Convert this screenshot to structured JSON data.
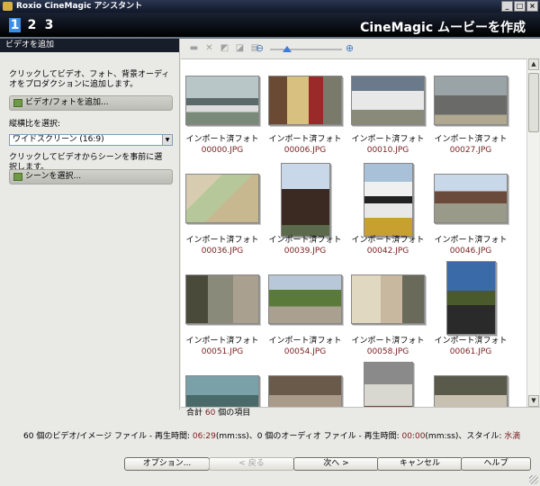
{
  "window": {
    "title": "Roxio CineMagic アシスタント"
  },
  "header": {
    "steps": [
      "1",
      "2",
      "3"
    ],
    "title": "CineMagic ムービーを作成"
  },
  "left_panel": {
    "title": "ビデオを追加",
    "description": "クリックしてビデオ、フォト、背景オーディオをプロダクションに追加します。",
    "add_button": "ビデオ/フォトを追加...",
    "aspect_label": "縦横比を選択:",
    "aspect_value": "ワイドスクリーン (16:9)",
    "scene_description": "クリックしてビデオからシーンを事前に選択します。",
    "scene_button": "シーンを選択..."
  },
  "media": {
    "items": [
      {
        "label": "インポート済フォト",
        "file": "00000.JPG",
        "icon": "penguins-photo"
      },
      {
        "label": "インポート済フォト",
        "file": "00006.JPG",
        "icon": "shop-front-photo"
      },
      {
        "label": "インポート済フォト",
        "file": "00010.JPG",
        "icon": "snowy-field-photo"
      },
      {
        "label": "インポート済フォト",
        "file": "00027.JPG",
        "icon": "elephant-photo"
      },
      {
        "label": "インポート済フォト",
        "file": "00036.JPG",
        "icon": "zoo-map-photo"
      },
      {
        "label": "インポート済フォト",
        "file": "00039.JPG",
        "icon": "pagoda-photo"
      },
      {
        "label": "インポート済フォト",
        "file": "00042.JPG",
        "icon": "panda-statue-photo"
      },
      {
        "label": "インポート済フォト",
        "file": "00046.JPG",
        "icon": "building-photo"
      },
      {
        "label": "インポート済フォト",
        "file": "00051.JPG",
        "icon": "elephants-photo"
      },
      {
        "label": "インポート済フォト",
        "file": "00054.JPG",
        "icon": "park-photo"
      },
      {
        "label": "インポート済フォト",
        "file": "00058.JPG",
        "icon": "info-board-photo"
      },
      {
        "label": "インポート済フォト",
        "file": "00061.JPG",
        "icon": "crowd-tree-photo"
      },
      {
        "label": "",
        "file": "",
        "icon": "aquarium-photo"
      },
      {
        "label": "",
        "file": "",
        "icon": "enclosure-photo"
      },
      {
        "label": "",
        "file": "",
        "icon": "bird-cage-photo"
      },
      {
        "label": "",
        "file": "",
        "icon": "cage-photo"
      }
    ]
  },
  "status": {
    "prefix": "合計",
    "count": "60",
    "suffix": "個の項目"
  },
  "summary": {
    "part1": "60 個のビデオ/イメージ ファイル - 再生時間: ",
    "video_duration": "06:29",
    "part2": "(mm:ss)、0 個のオーディオ ファイル - 再生時間: ",
    "audio_duration": "00:00",
    "part3": "(mm:ss)、スタイル: ",
    "style": "水滴"
  },
  "buttons": {
    "options": "オプション...",
    "back": "< 戻る",
    "next": "次へ >",
    "cancel": "キャンセル",
    "help": "ヘルプ"
  },
  "colors": {
    "accent": "#3b8ee8",
    "header": "#000000",
    "filename": "#7a2222"
  }
}
